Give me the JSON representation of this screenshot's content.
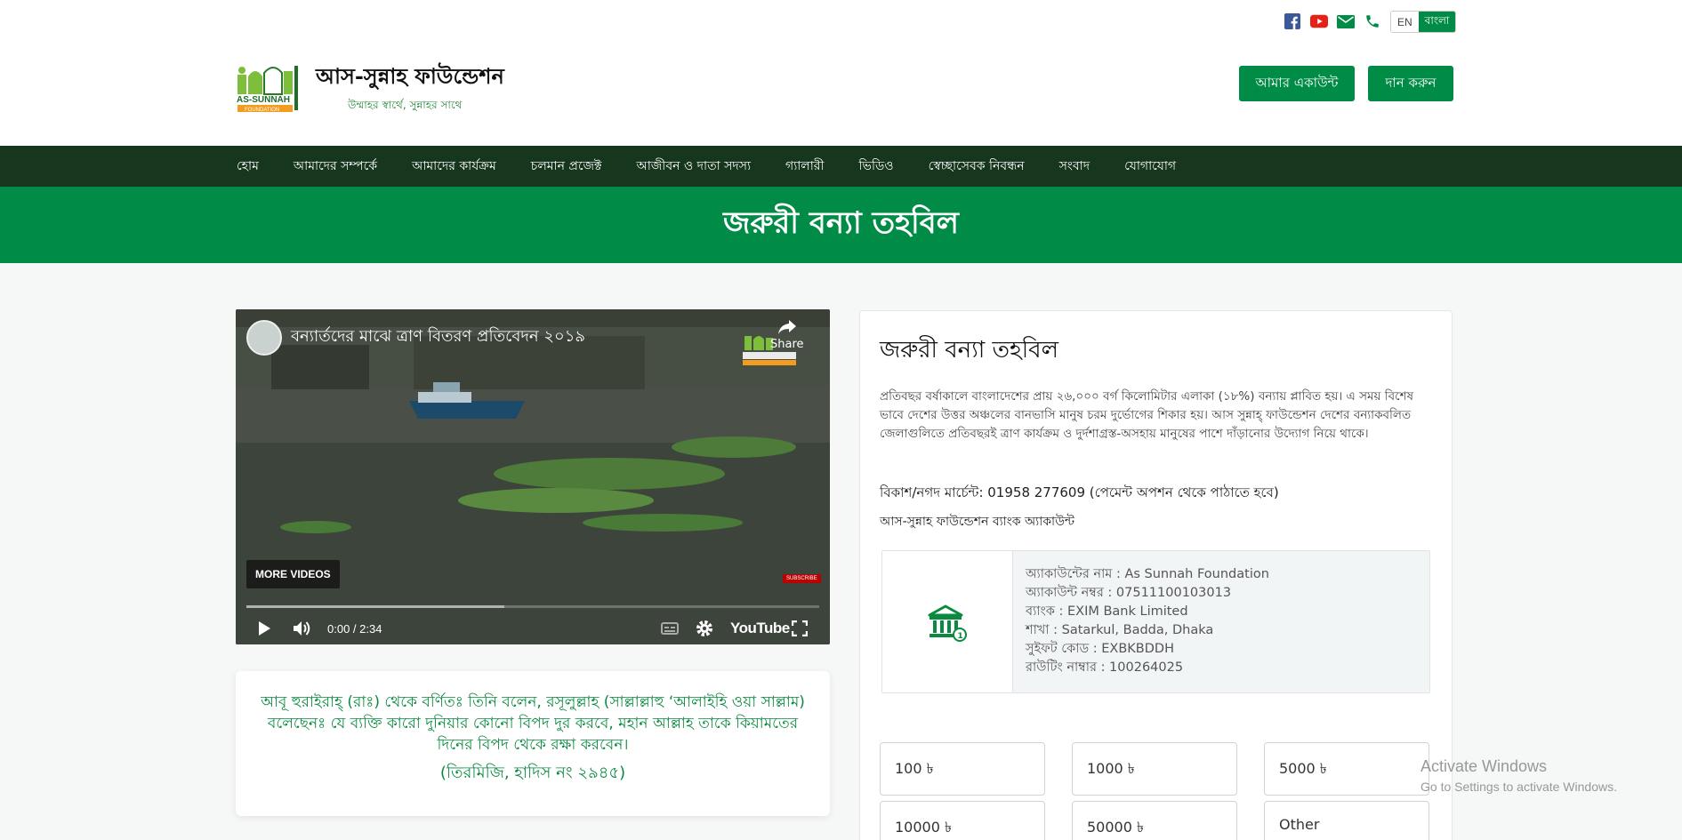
{
  "header": {
    "social": [
      {
        "icon": "facebook-icon",
        "color": "#3b5998"
      },
      {
        "icon": "youtube-icon",
        "color": "#e62117"
      },
      {
        "icon": "email-icon",
        "color": "#008b46"
      },
      {
        "icon": "phone-icon",
        "color": "#008b46"
      }
    ],
    "lang_en": "EN",
    "lang_bn": "বাংলা",
    "logo_title": "আস-সুন্নাহ ফাউন্ডেশন",
    "logo_tagline": "উম্মাহর স্বার্থে, সুন্নাহর সাথে",
    "logo_mark_text": "AS-SUNNAH",
    "logo_mark_sub": "FOUNDATION",
    "account_button": "আমার একাউন্ট",
    "donate_button": "দান করুন"
  },
  "nav": {
    "items": [
      "হোম",
      "আমাদের সম্পর্কে",
      "আমাদের কার্যক্রম",
      "চলমান প্রজেক্ট",
      "আজীবন ও দাতা সদস্য",
      "গ্যালারী",
      "ভিডিও",
      "স্বেচ্ছাসেবক নিবন্ধন",
      "সংবাদ",
      "যোগাযোগ"
    ]
  },
  "banner": {
    "title": "জরুরী বন্যা তহবিল"
  },
  "video": {
    "title": "বন্যার্তদের মাঝে ত্রাণ বিতরণ প্রতিবেদন ২০১৯",
    "share_label": "Share",
    "more_videos": "MORE VIDEOS",
    "subscribe": "SUBSCRIBE",
    "time": "0:00 / 2:34",
    "youtube_label": "YouTube",
    "buffered_fraction": 0.45
  },
  "hadith": {
    "text": "আবূ হুরাইরাহ্ (রাঃ) থেকে বর্ণিতঃ তিনি বলেন, রসূলুল্লাহ (সাল্লাল্লাহু ‘আলাইহি ওয়া সাল্লাম) বলেছেনঃ যে ব্যক্তি কারো দুনিয়ার কোনো বিপদ দুর করবে, মহান আল্লাহ তাকে কিয়ামতের দিনের বিপদ থেকে রক্ষা করবেন।",
    "reference": "(তিরমিজি, হাদিস নং ২৯৪৫)"
  },
  "fund": {
    "title": "জরুরী বন্যা তহবিল",
    "description": "প্রতিবছর বর্ষাকালে বাংলাদেশের প্রায় ২৬,০০০ বর্গ কিলোমিটার এলাকা (১৮%) বন্যায় প্লাবিত হয়। এ সময় বিশেষ ভাবে দেশের উত্তর অঞ্চলের বানভাসি মানুষ চরম দুর্ভোগের শিকার হয়। আস সুন্নাহ্‌ ফাউন্ডেশন দেশের বন্যাকবলিত জেলাগুলিতে প্রতিবছরই ত্রাণ কার্যক্রম ও দুর্দশাগ্রস্ত-অসহায় মানুষের পাশে দাঁড়ানোর উদ্যোগ নিয়ে থাকে।",
    "bkash": "বিকাশ/নগদ মার্চেন্ট: 01958 277609  (পেমেন্ট অপশন থেকে পাঠাতে হবে)",
    "bank_title": "আস-সুন্নাহ ফাউন্ডেশন ব্যাংক অ্যাকাউন্ট",
    "bank": {
      "account_name": "অ্যাকাউন্টের নাম : As Sunnah Foundation",
      "account_number": "অ্যাকাউন্ট নম্বর : 07511100103013",
      "bank_name": "ব্যাংক : EXIM Bank Limited",
      "branch": "শাখা : Satarkul, Badda, Dhaka",
      "swift": "সুইফট কোড : EXBKBDDH",
      "routing": "রাউটিং নাম্বার : 100264025"
    },
    "amounts": [
      "100 ৳",
      "1000 ৳",
      "5000 ৳",
      "10000 ৳",
      "50000 ৳",
      "Other"
    ]
  },
  "watermark": {
    "line1": "Activate Windows",
    "line2": "Go to Settings to activate Windows."
  },
  "colors": {
    "primary": "#008b46",
    "nav_bg": "#16361e",
    "hadith_text": "#0a8a3f"
  }
}
